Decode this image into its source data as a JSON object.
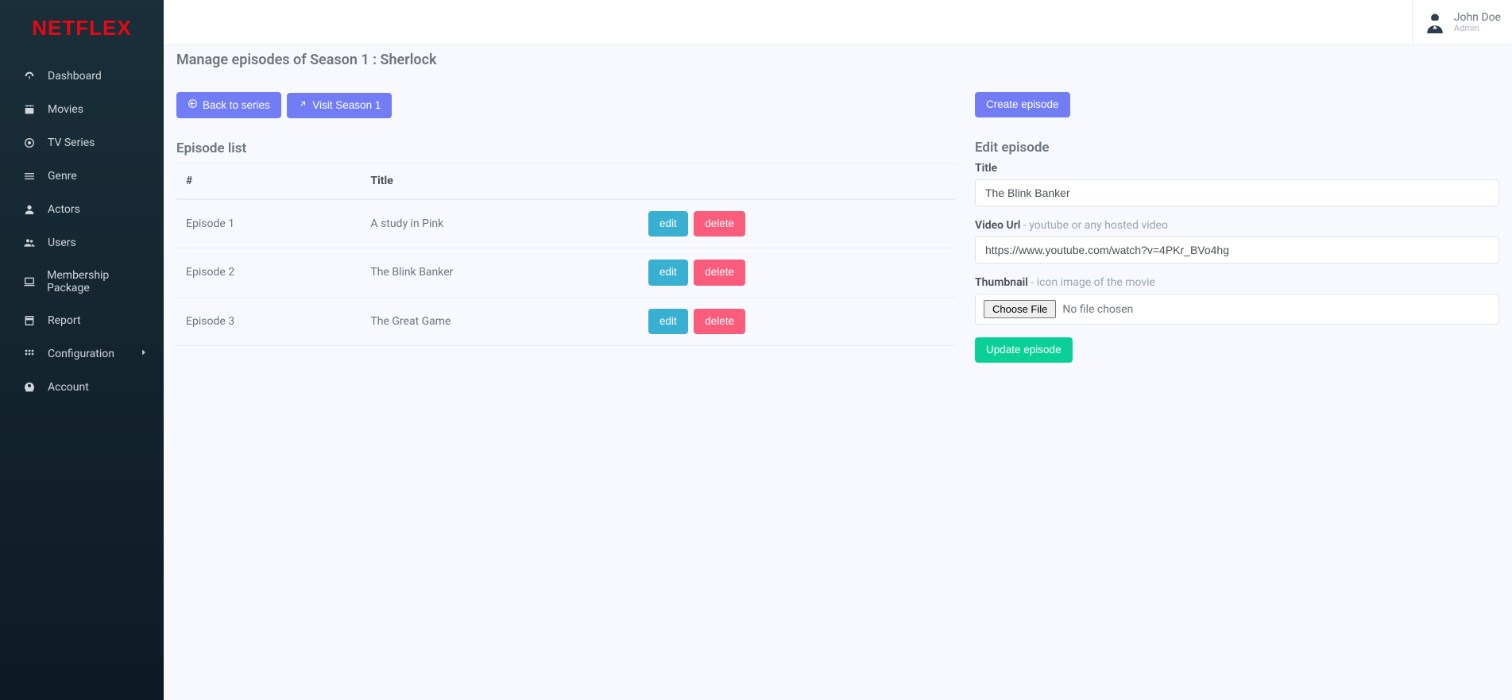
{
  "app_name": "NETFLEX",
  "user": {
    "name": "John Doe",
    "role": "Admin"
  },
  "sidebar": {
    "items": [
      {
        "label": "Dashboard",
        "icon": "dashboard"
      },
      {
        "label": "Movies",
        "icon": "movie"
      },
      {
        "label": "TV Series",
        "icon": "tv"
      },
      {
        "label": "Genre",
        "icon": "list"
      },
      {
        "label": "Actors",
        "icon": "person"
      },
      {
        "label": "Users",
        "icon": "users"
      },
      {
        "label": "Membership Package",
        "icon": "laptop"
      },
      {
        "label": "Report",
        "icon": "report"
      },
      {
        "label": "Configuration",
        "icon": "grid",
        "expandable": true
      },
      {
        "label": "Account",
        "icon": "account"
      }
    ]
  },
  "page": {
    "title": "Manage episodes of Season 1 : Sherlock",
    "back_label": "Back to series",
    "visit_label": "Visit Season 1",
    "create_label": "Create episode",
    "list_title": "Episode list",
    "edit_title": "Edit episode",
    "table_headers": {
      "num": "#",
      "title": "Title"
    },
    "episodes": [
      {
        "num": "Episode 1",
        "title": "A study in Pink"
      },
      {
        "num": "Episode 2",
        "title": "The Blink Banker"
      },
      {
        "num": "Episode 3",
        "title": "The Great Game"
      }
    ],
    "actions": {
      "edit": "edit",
      "delete": "delete"
    }
  },
  "form": {
    "title_label": "Title",
    "title_value": "The Blink Banker",
    "url_label": "Video Url",
    "url_hint": " - youtube or any hosted video",
    "url_value": "https://www.youtube.com/watch?v=4PKr_BVo4hg",
    "thumb_label": "Thumbnail",
    "thumb_hint": " - icon image of the movie",
    "file_button": "Choose File",
    "file_placeholder": "No file chosen",
    "submit_label": "Update episode"
  }
}
